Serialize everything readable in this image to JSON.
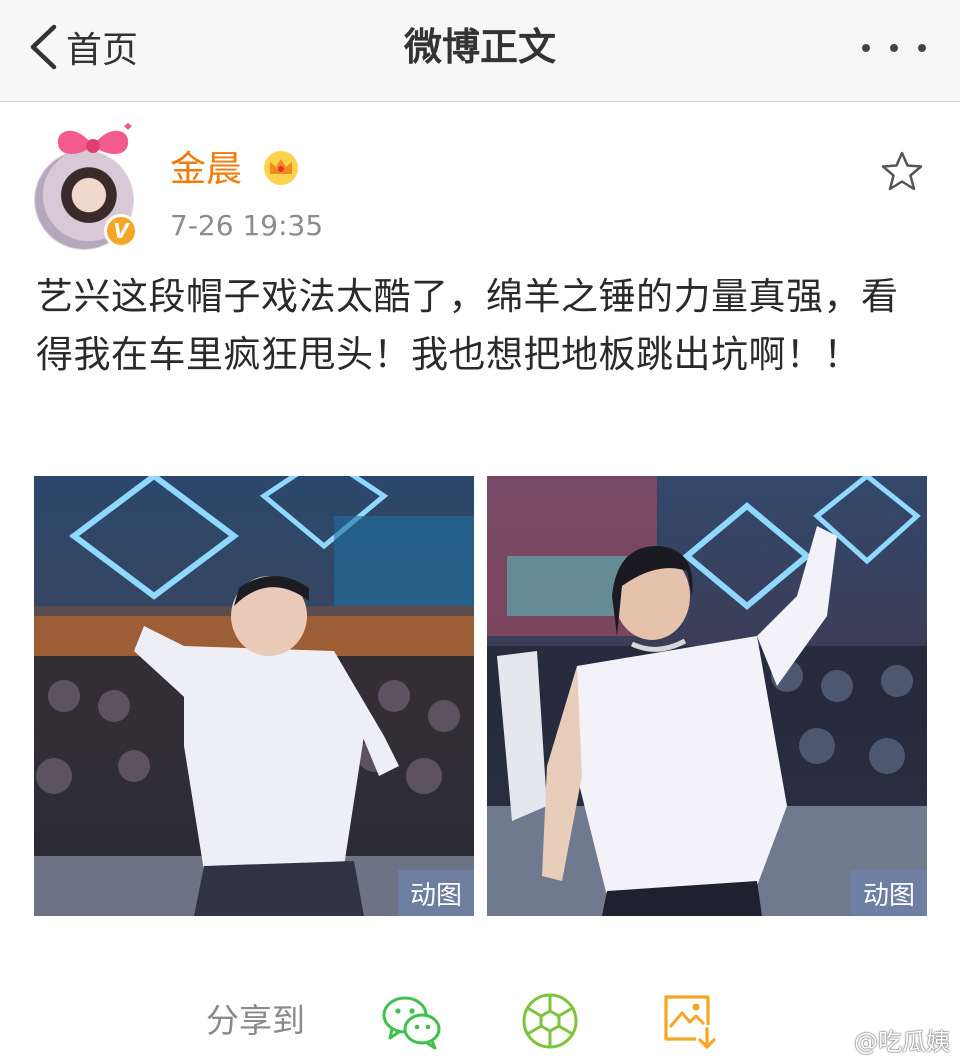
{
  "nav": {
    "back_label": "首页",
    "title": "微博正文"
  },
  "post": {
    "user_name": "金晨",
    "time": "7-26 19:35",
    "text": "艺兴这段帽子戏法太酷了，绵羊之锤的力量真强，看得我在车里疯狂甩头！我也想把地板跳出坑啊！！",
    "verified_badge": "V",
    "images": [
      {
        "tag": "动图"
      },
      {
        "tag": "动图"
      }
    ]
  },
  "share": {
    "label": "分享到",
    "icons": [
      "wechat-icon",
      "moments-icon",
      "save-image-icon"
    ]
  },
  "watermark": {
    "text": "@吃瓜姨"
  },
  "colors": {
    "username": "#f27b0b",
    "wechat_green": "#3fc04a",
    "save_orange": "#f5a623",
    "navbar_bg": "#f7f7f7"
  }
}
